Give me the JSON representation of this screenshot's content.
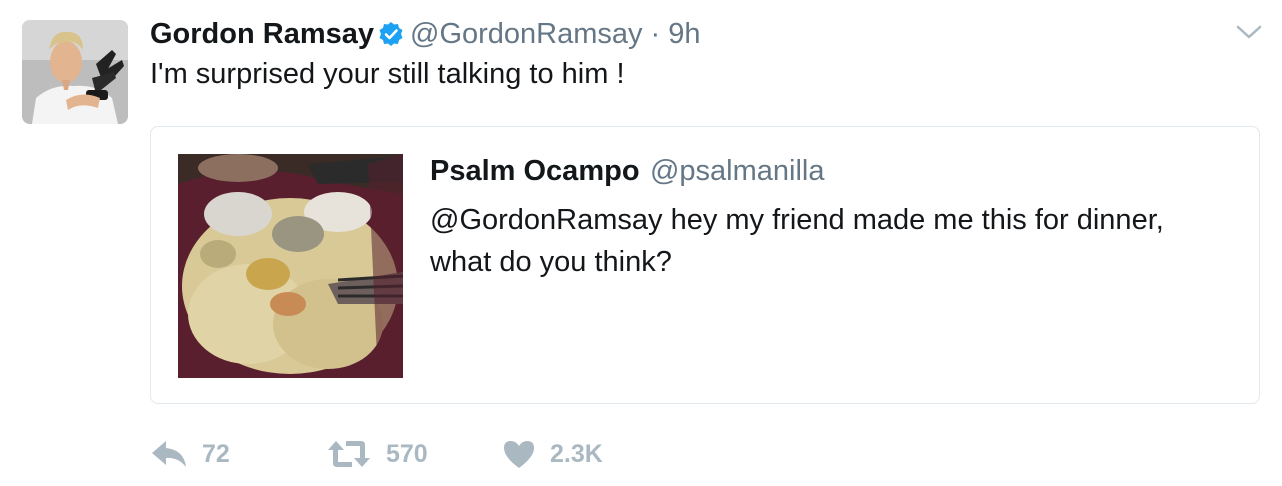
{
  "tweet": {
    "author_name": "Gordon Ramsay",
    "author_handle": "@GordonRamsay",
    "separator": "·",
    "time": "9h",
    "text": "I'm surprised your still talking to him !",
    "icons": {
      "verified": "verified-badge-icon",
      "menu": "chevron-down-icon"
    },
    "colors": {
      "verified": "#1da1f2",
      "secondary_text": "#657786",
      "action_icons": "#aab8c2"
    }
  },
  "quote": {
    "author_name": "Psalm Ocampo",
    "author_handle": "@psalmanilla",
    "text": "@GordonRamsay hey my friend made me this for dinner, what do you think?"
  },
  "actions": {
    "reply_count": "72",
    "retweet_count": "570",
    "like_count": "2.3K"
  }
}
